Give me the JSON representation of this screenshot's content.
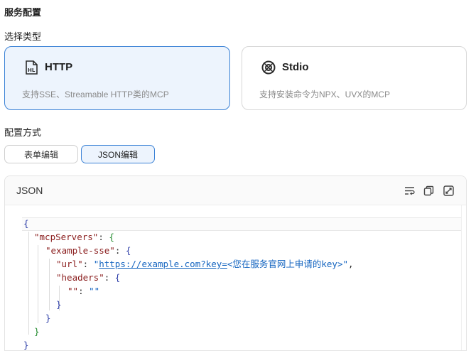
{
  "sections": {
    "service_config": "服务配置",
    "select_type": "选择类型",
    "config_method": "配置方式"
  },
  "types": [
    {
      "name": "HTTP",
      "desc": "支持SSE、Streamable HTTP类的MCP",
      "selected": true,
      "icon": "http-icon"
    },
    {
      "name": "Stdio",
      "desc": "支持安装命令为NPX、UVX的MCP",
      "selected": false,
      "icon": "stdio-icon"
    }
  ],
  "modes": [
    {
      "label": "表单编辑",
      "selected": false
    },
    {
      "label": "JSON编辑",
      "selected": true
    }
  ],
  "editor": {
    "title": "JSON",
    "tools": [
      "format-icon",
      "copy-icon",
      "fullscreen-icon"
    ],
    "code": {
      "open": "{",
      "k_mcpServers": "\"mcpServers\"",
      "k_example": "\"example-sse\"",
      "k_url": "\"url\"",
      "url_value": "https://example.com?key=",
      "url_rest": "<您在服务官网上申请的key>",
      "k_headers": "\"headers\"",
      "empty_key": "\"\"",
      "empty_val": "\"\""
    }
  },
  "colors": {
    "accent": "#3b82d6",
    "selected_bg": "#edf4fd"
  }
}
